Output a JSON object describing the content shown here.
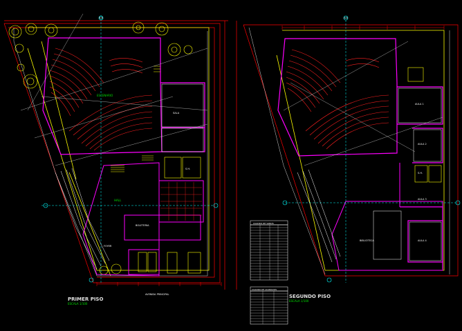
{
  "drawing": {
    "plan_left_title": "PRIMER PISO",
    "plan_left_scale": "ESCALA 1/100",
    "plan_right_title": "SEGUNDO PISO",
    "plan_right_scale": "ESCALA 1/100",
    "bottom_caption": "AVENIDA PRINCIPAL",
    "section_marks": [
      "B-B",
      "A-A"
    ],
    "colors": {
      "background": "#000000",
      "wall": "#ff00ff",
      "dimension": "#ff0000",
      "seating": "#ff2020",
      "trees": "#ffff00",
      "text": "#ffffff",
      "label_green": "#00e000",
      "axis": "#00ffff"
    },
    "room_labels_left": [
      "ESCENARIO",
      "SALA",
      "HALL",
      "S.H.",
      "BOLETERIA",
      "FOYER"
    ],
    "room_labels_right": [
      "AULA 1",
      "AULA 2",
      "AULA 3",
      "AULA 4",
      "S.H.",
      "BIBLIOTECA"
    ]
  },
  "tables": {
    "upper_title": "CUADRO DE VANOS",
    "lower_title": "CUADRO DE ACABADOS"
  }
}
